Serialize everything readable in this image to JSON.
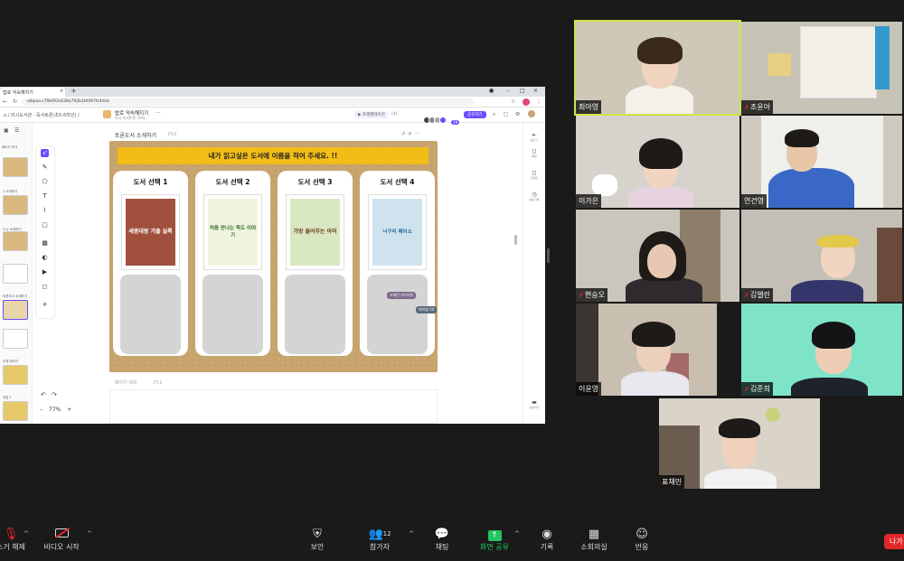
{
  "browser": {
    "tab_title": "밥로 익숙해지기",
    "url": "allquio.c7fb093c638a792b2bf497fc4dcb",
    "crumb": "⌂ / 미시도서관 - 독서토론(초5-6학년) /",
    "doc_title": "밥로 익숙해지기",
    "doc_sub": "미시 독서토론 10차",
    "present_label": "▶ 프레젠테이션",
    "share_label": "공유하기",
    "participant_count": "19"
  },
  "pages": {
    "add_label": "페이지 추가",
    "thumb_labels": [
      "1 소개하기",
      "3 나 소개하기",
      "토론도서 소개하기",
      "주제 정하기",
      "게임 1",
      "게임 2"
    ],
    "current_label": "토론도서 소개하기",
    "current_num": "P10",
    "next_label": "페이지 제목",
    "next_num": "P11",
    "zoom": "77%"
  },
  "board": {
    "banner": "내가 읽고싶은 도서에 이름을 적어 주세요. !!",
    "cards": [
      {
        "title": "도서 선택 1",
        "book": "세종대왕 가출 실록",
        "color": "#a0503c"
      },
      {
        "title": "도서 선택 2",
        "book": "처음 만나는 독도 이야기",
        "color": "#eef4e0"
      },
      {
        "title": "도서 선택 3",
        "book": "가방 들어주는 아이",
        "color": "#d8e8c0"
      },
      {
        "title": "도서 선택 4",
        "book": "너구리 페이소",
        "color": "#cfe3ee"
      }
    ],
    "cursor_1": "조재민 (미하원)",
    "cursor_2": "미하원 50"
  },
  "right_tools": [
    "숨기기",
    "채팅",
    "코멘트",
    "활동기록",
    "공유하기"
  ],
  "participants": [
    {
      "name": "최아영",
      "muted": false
    },
    {
      "name": "조윤아",
      "muted": true
    },
    {
      "name": "이가은",
      "muted": false
    },
    {
      "name": "연건영",
      "muted": false
    },
    {
      "name": "현승오",
      "muted": true
    },
    {
      "name": "김엘린",
      "muted": true
    },
    {
      "name": "이윤영",
      "muted": false
    },
    {
      "name": "김준희",
      "muted": true
    },
    {
      "name": "표채민",
      "muted": false
    }
  ],
  "controls": {
    "mute": "소거 해제",
    "video": "비디오 시작",
    "security": "보안",
    "participants": "참가자",
    "participants_count": "12",
    "chat": "채팅",
    "share": "화면 공유",
    "record": "기록",
    "breakout": "소회의실",
    "reactions": "반응",
    "leave": "나가"
  },
  "colors": {
    "accent": "#6a4bff",
    "banner": "#f2bd17",
    "share_green": "#22c55e",
    "leave_red": "#e02828",
    "active_speaker": "#cde54b"
  }
}
